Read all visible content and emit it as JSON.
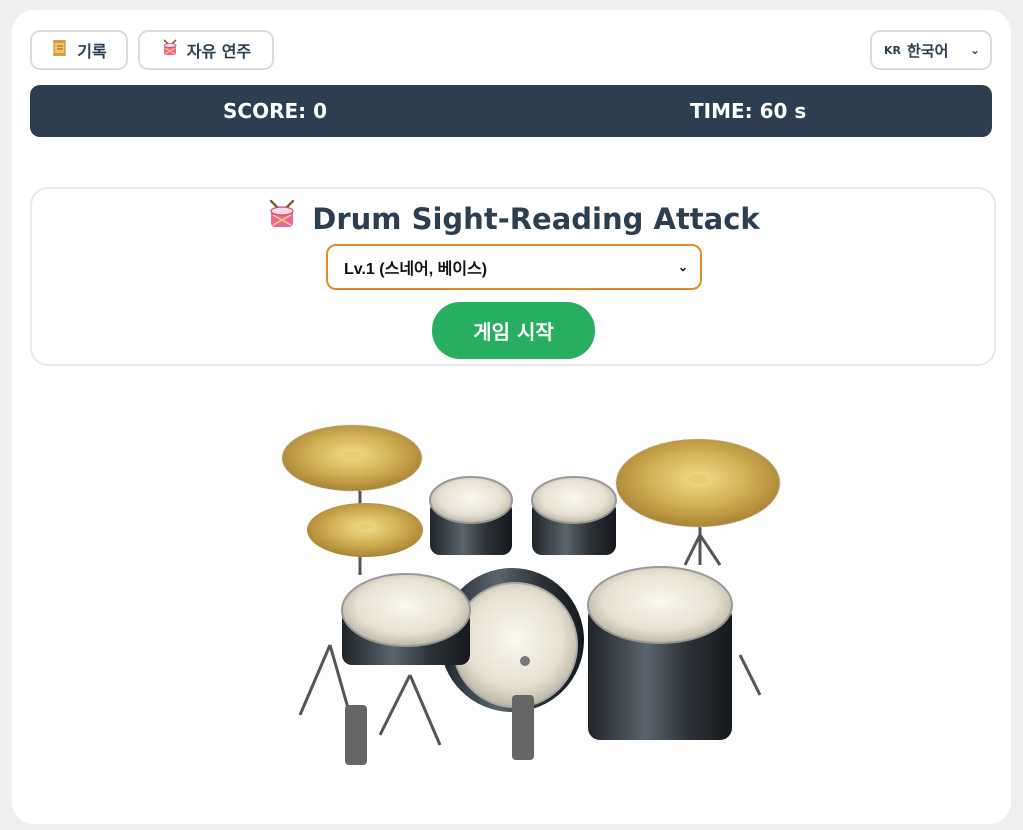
{
  "toolbar": {
    "records_label": "기록",
    "records_icon": "scroll-icon",
    "free_play_label": "자유 연주",
    "free_play_icon": "drum-icon"
  },
  "language": {
    "flag_code": "KR",
    "selected": "한국어"
  },
  "status": {
    "score_text": "SCORE: 0",
    "time_text": "TIME: 60 s"
  },
  "game": {
    "title": "Drum Sight-Reading Attack",
    "title_icon": "drum-icon",
    "level_selected": "Lv.1 (스네어, 베이스)",
    "start_label": "게임 시작"
  },
  "colors": {
    "dark": "#2c3e50",
    "start_green": "#27ae60",
    "select_border": "#e08b2e"
  }
}
